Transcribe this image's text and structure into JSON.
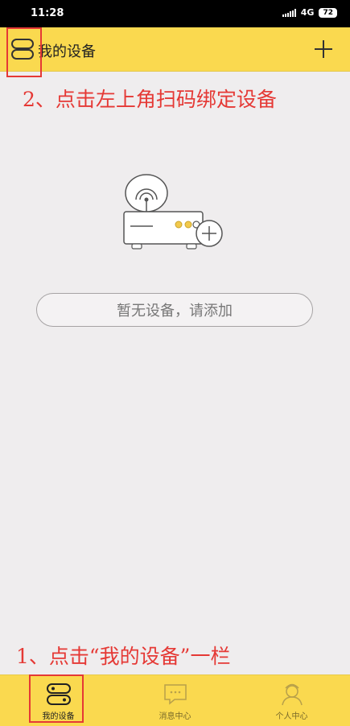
{
  "status_bar": {
    "time": "11:28",
    "network": "4G",
    "battery": "72"
  },
  "header": {
    "title": "我的设备",
    "menu_icon": "device-list-icon",
    "add_icon": "plus-icon"
  },
  "annotations": {
    "step2": "2、点击左上角扫码绑定设备",
    "step1": "1、点击“我的设备”一栏"
  },
  "empty_state": {
    "illustration_icon": "router-add-icon",
    "message": "暂无设备，请添加"
  },
  "bottom_nav": {
    "items": [
      {
        "label": "我的设备",
        "icon": "device-icon",
        "active": true
      },
      {
        "label": "消息中心",
        "icon": "message-icon",
        "active": false
      },
      {
        "label": "个人中心",
        "icon": "user-icon",
        "active": false
      }
    ]
  },
  "colors": {
    "accent": "#fad94f",
    "annotation": "#e53935",
    "background": "#efedee"
  }
}
